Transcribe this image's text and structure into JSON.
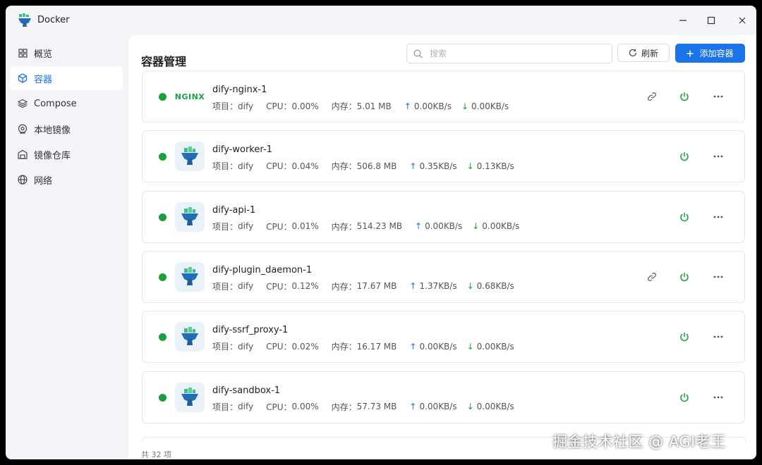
{
  "window": {
    "title": "Docker"
  },
  "sidebar": {
    "items": [
      {
        "label": "概览",
        "icon": "grid-icon",
        "active": false
      },
      {
        "label": "容器",
        "icon": "cube-icon",
        "active": true
      },
      {
        "label": "Compose",
        "icon": "layers-icon",
        "active": false
      },
      {
        "label": "本地镜像",
        "icon": "disc-icon",
        "active": false
      },
      {
        "label": "镜像仓库",
        "icon": "warehouse-icon",
        "active": false
      },
      {
        "label": "网络",
        "icon": "globe-icon",
        "active": false
      }
    ]
  },
  "header": {
    "title": "容器管理",
    "search_placeholder": "搜索",
    "refresh_label": "刷新",
    "add_label": "添加容器"
  },
  "labels": {
    "project": "项目：",
    "cpu": "CPU：",
    "mem": "内存："
  },
  "containers": [
    {
      "name": "dify-nginx-1",
      "project": "dify",
      "cpu": "0.00%",
      "mem": "5.01 MB",
      "up": "0.00KB/s",
      "down": "0.00KB/s",
      "logo": "nginx",
      "logo_text": "NGINX",
      "has_link": true,
      "status": "running"
    },
    {
      "name": "dify-worker-1",
      "project": "dify",
      "cpu": "0.04%",
      "mem": "506.8 MB",
      "up": "0.35KB/s",
      "down": "0.13KB/s",
      "logo": "docker",
      "has_link": false,
      "status": "running"
    },
    {
      "name": "dify-api-1",
      "project": "dify",
      "cpu": "0.01%",
      "mem": "514.23 MB",
      "up": "0.00KB/s",
      "down": "0.00KB/s",
      "logo": "docker",
      "has_link": false,
      "status": "running"
    },
    {
      "name": "dify-plugin_daemon-1",
      "project": "dify",
      "cpu": "0.12%",
      "mem": "17.67 MB",
      "up": "1.37KB/s",
      "down": "0.68KB/s",
      "logo": "docker",
      "has_link": true,
      "status": "running"
    },
    {
      "name": "dify-ssrf_proxy-1",
      "project": "dify",
      "cpu": "0.02%",
      "mem": "16.17 MB",
      "up": "0.00KB/s",
      "down": "0.00KB/s",
      "logo": "docker",
      "has_link": false,
      "status": "running"
    },
    {
      "name": "dify-sandbox-1",
      "project": "dify",
      "cpu": "0.00%",
      "mem": "57.73 MB",
      "up": "0.00KB/s",
      "down": "0.00KB/s",
      "logo": "docker",
      "has_link": false,
      "status": "running"
    }
  ],
  "footer": {
    "total": "共 32 项"
  },
  "watermark": "掘金技术社区 @ AGI老王",
  "colors": {
    "accent": "#1a73e8",
    "running": "#18a13b",
    "up_arrow": "#1a73e8",
    "down_arrow": "#18a13b"
  }
}
